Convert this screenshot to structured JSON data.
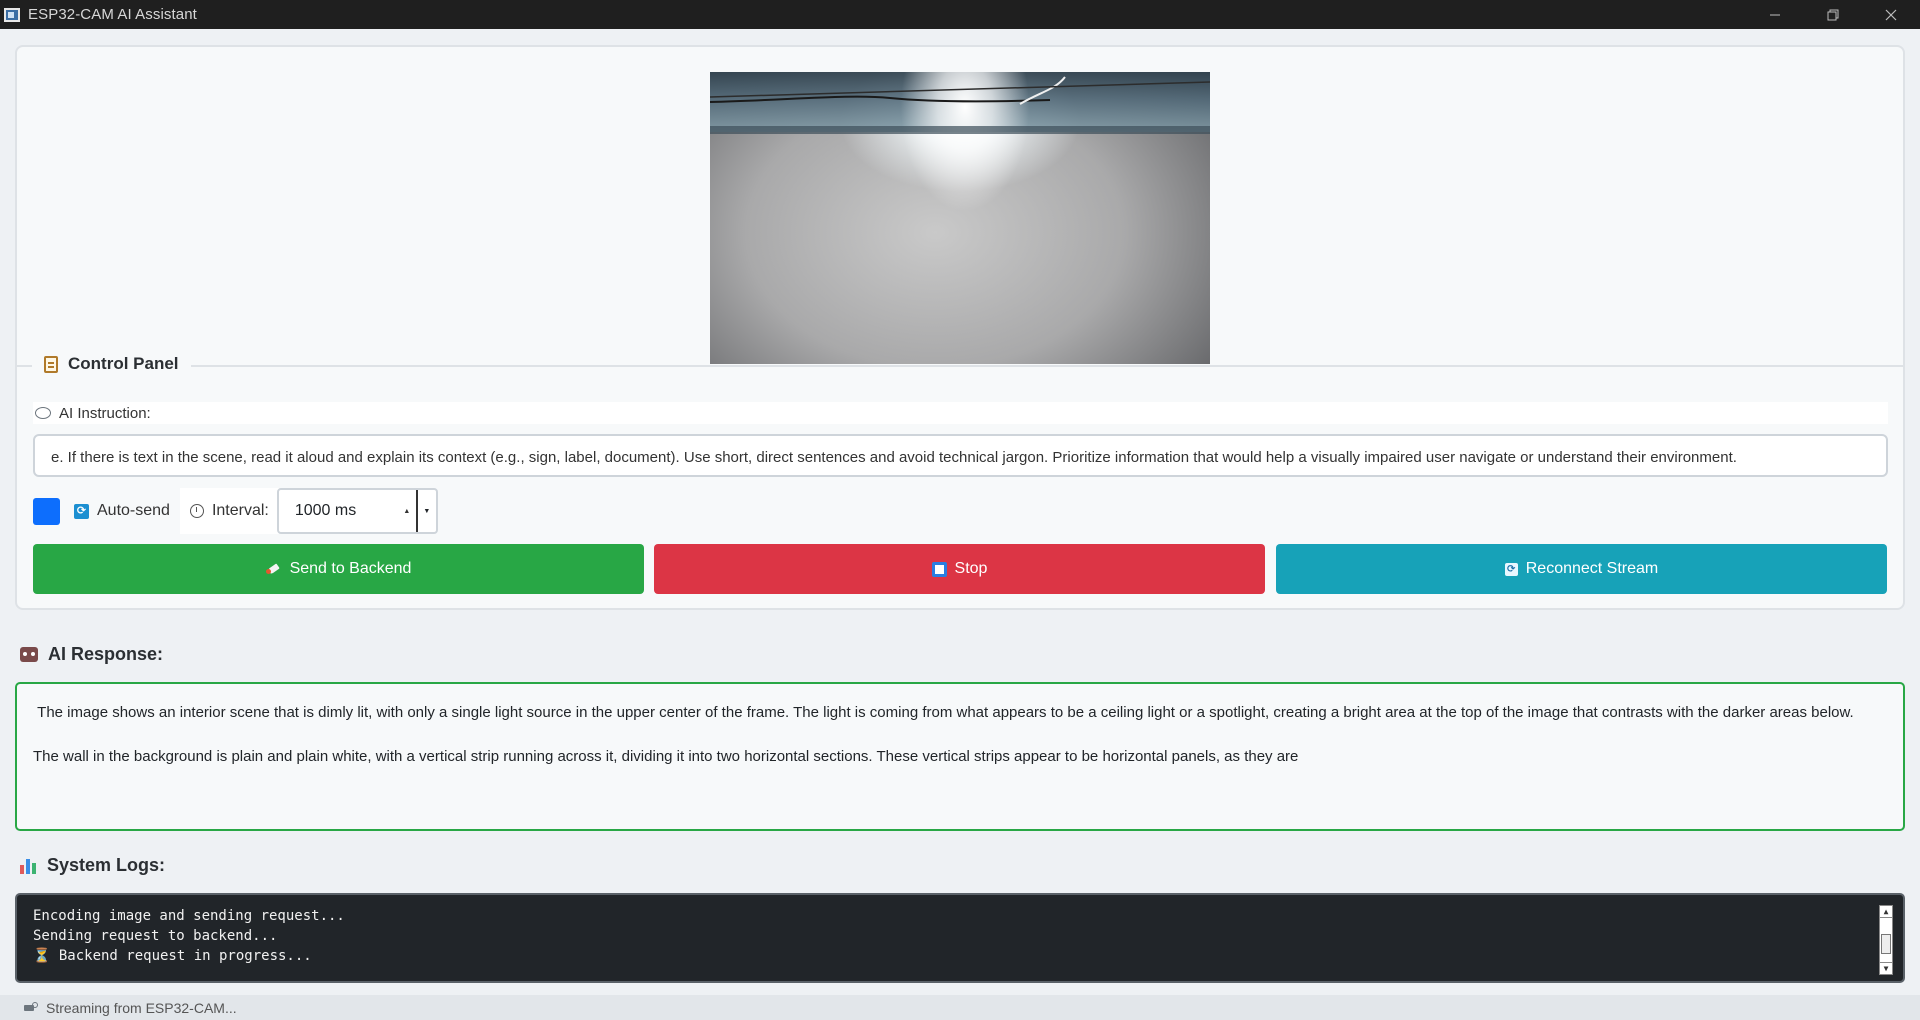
{
  "window": {
    "title": "ESP32-CAM AI Assistant",
    "controls": [
      "minimize-icon",
      "restore-icon",
      "close-icon"
    ]
  },
  "control_panel": {
    "title": "Control Panel",
    "instruction_label": "AI Instruction:",
    "instruction_value": "e. If there is text in the scene, read it aloud and explain its context (e.g., sign, label, document). Use short, direct sentences and avoid technical jargon. Prioritize information that would help a visually impaired user navigate or understand their environment.",
    "auto_send_label": "Auto-send",
    "auto_send_checked": true,
    "interval_label": "Interval:",
    "interval_value": "1000 ms",
    "buttons": {
      "send": "Send to Backend",
      "stop": "Stop",
      "reconnect": "Reconnect Stream"
    }
  },
  "ai_response": {
    "heading": "AI Response:",
    "paragraphs": [
      " The image shows an interior scene that is dimly lit, with only a single light source in the upper center of the frame. The light is coming from what appears to be a ceiling light or a spotlight, creating a bright area at the top of the image that contrasts with the darker areas below.",
      "The wall in the background is plain and plain white, with a vertical strip running across it, dividing it into two horizontal sections. These vertical strips appear to be horizontal panels, as they are"
    ]
  },
  "system_logs": {
    "heading": "System Logs:",
    "lines": [
      "Encoding image and sending request...",
      "Sending request to backend...",
      "⏳ Backend request in progress..."
    ]
  },
  "status_bar": {
    "text": "Streaming from ESP32-CAM..."
  },
  "colors": {
    "send": "#28a745",
    "stop": "#dc3545",
    "reconnect": "#17a2b8",
    "checkbox": "#0d6efd",
    "log_bg": "#212529"
  }
}
